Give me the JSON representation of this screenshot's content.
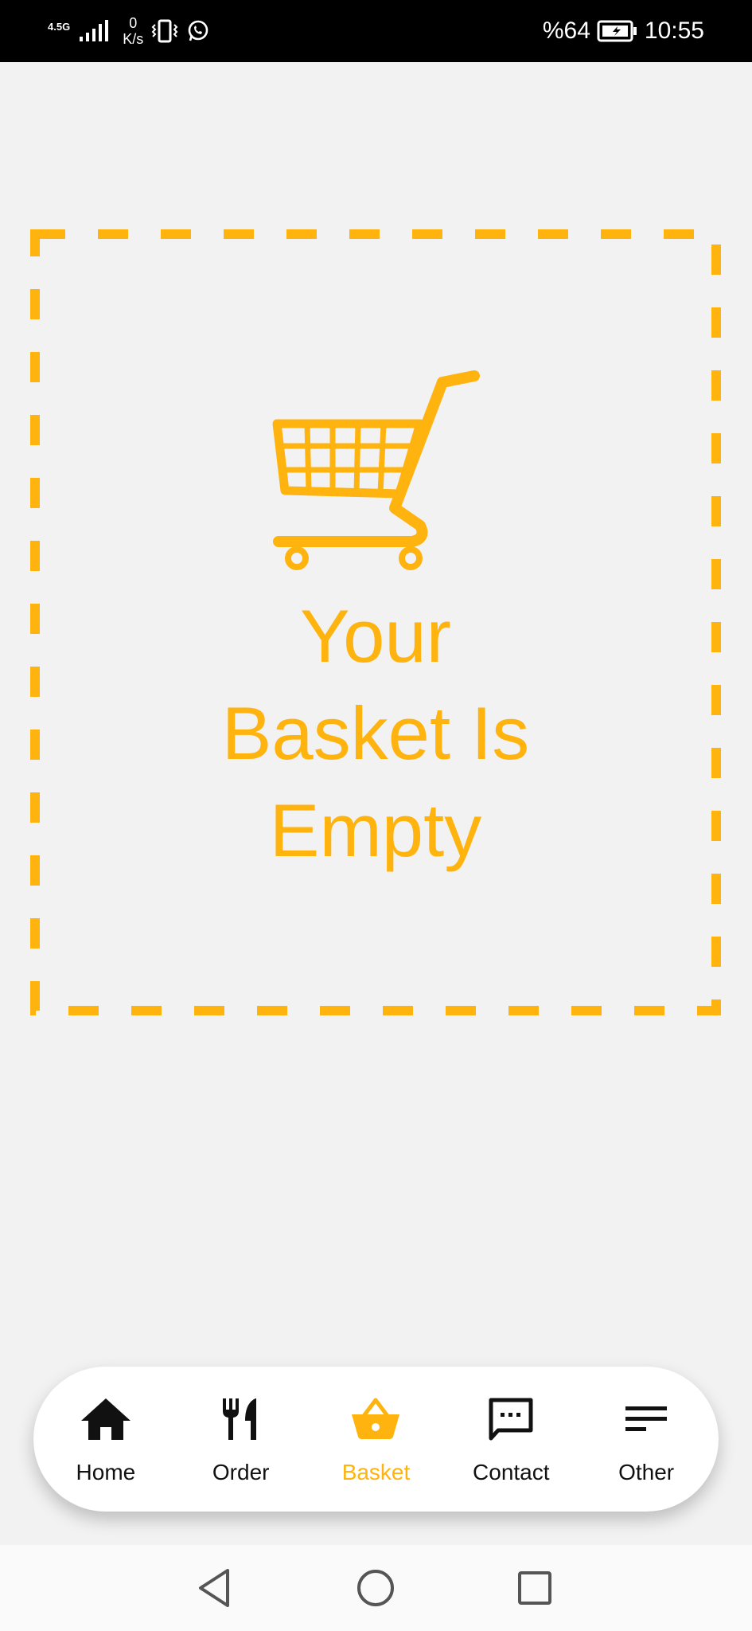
{
  "status_bar": {
    "network_type": "4.5G",
    "speed_value": "0",
    "speed_unit": "K/s",
    "battery_text": "%64",
    "time": "10:55"
  },
  "empty_state": {
    "title_line1": "Your",
    "title_line2": "Basket Is",
    "title_line3": "Empty",
    "icon": "shopping-cart-icon"
  },
  "colors": {
    "accent": "#ffb30f",
    "background": "#f2f2f2",
    "nav_background": "#ffffff",
    "text_dark": "#111111"
  },
  "bottom_nav": {
    "items": [
      {
        "label": "Home",
        "icon": "home-icon",
        "active": false
      },
      {
        "label": "Order",
        "icon": "fork-knife-icon",
        "active": false
      },
      {
        "label": "Basket",
        "icon": "basket-icon",
        "active": true
      },
      {
        "label": "Contact",
        "icon": "message-icon",
        "active": false
      },
      {
        "label": "Other",
        "icon": "menu-lines-icon",
        "active": false
      }
    ]
  },
  "system_nav": {
    "back": "back-icon",
    "home": "home-circle-icon",
    "recents": "recents-icon"
  }
}
